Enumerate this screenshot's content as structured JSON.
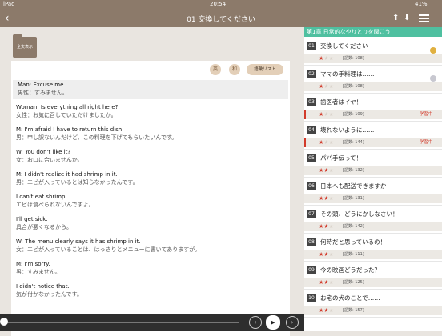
{
  "status": {
    "carrier": "iPad",
    "time": "20:54",
    "battery": "41%"
  },
  "nav": {
    "back_icon": "‹",
    "title": "01 交換してください",
    "up_icon": "⬆",
    "down_icon": "⬇"
  },
  "left": {
    "full_text_label": "全文表示",
    "btn_en": "英",
    "btn_jp": "和",
    "vocab_label": "語彙リスト",
    "lines": [
      {
        "en": "Man: Excuse me.",
        "jp": "男性：すみません。"
      },
      {
        "en": "Woman: Is everything all right here?",
        "jp": "女性：お気に召していただけましたか。"
      },
      {
        "en": "M: I'm afraid I have to return this dish.",
        "jp": "男：申し訳ないんだけど、この料理を下げてもらいたいんです。"
      },
      {
        "en": "W: You don't like it?",
        "jp": "女：お口に合いませんか。"
      },
      {
        "en": "M: I didn't realize it had shrimp in it.",
        "jp": "男：エビが入っているとは知らなかったんです。"
      },
      {
        "en": "I can't eat shrimp.",
        "jp": "エビは食べられないんですよ。"
      },
      {
        "en": "I'll get sick.",
        "jp": "具合が悪くなるから。"
      },
      {
        "en": "W: The menu clearly says it has shrimp in it.",
        "jp": "女：エビが入っていることは、はっきりとメニューに書いてありますが。"
      },
      {
        "en": "M: I'm sorry.",
        "jp": "男：すみません。"
      },
      {
        "en": "I didn't notice that.",
        "jp": "気が付かなかったんです。"
      }
    ]
  },
  "player": {
    "prev_icon": "‹",
    "play_icon": "▶",
    "next_icon": "›"
  },
  "right": {
    "chapter": "第1章 日常的なやりとりを聞こう",
    "items": [
      {
        "num": "01",
        "title": "交換してください",
        "stars": 1,
        "count": "[語数: 108]",
        "badge": "",
        "medal": "gold"
      },
      {
        "num": "02",
        "title": "ママの手料理は……",
        "stars": 1,
        "count": "[語数: 108]",
        "badge": "",
        "medal": "silver"
      },
      {
        "num": "03",
        "title": "歯医者はイヤ！",
        "stars": 1,
        "count": "[語数: 109]",
        "badge": "学習中",
        "medal": ""
      },
      {
        "num": "04",
        "title": "壊れないように……",
        "stars": 1,
        "count": "[語数: 144]",
        "badge": "学習中",
        "medal": ""
      },
      {
        "num": "05",
        "title": "パパ手伝って！",
        "stars": 2,
        "count": "[語数: 132]",
        "badge": "",
        "medal": ""
      },
      {
        "num": "06",
        "title": "日本へも配送できますか",
        "stars": 2,
        "count": "[語数: 131]",
        "badge": "",
        "medal": ""
      },
      {
        "num": "07",
        "title": "その頭、どうにかしなさい！",
        "stars": 2,
        "count": "[語数: 142]",
        "badge": "",
        "medal": ""
      },
      {
        "num": "08",
        "title": "何時だと思っているの！",
        "stars": 2,
        "count": "[語数: 111]",
        "badge": "",
        "medal": ""
      },
      {
        "num": "09",
        "title": "今の映画どうだった？",
        "stars": 2,
        "count": "[語数: 125]",
        "badge": "",
        "medal": ""
      },
      {
        "num": "10",
        "title": "お宅の犬のことで……",
        "stars": 2,
        "count": "[語数: 157]",
        "badge": "",
        "medal": ""
      }
    ]
  },
  "colors": {
    "brand": "#8c7a6a",
    "chapter": "#4fc0a0",
    "star": "#d23a2a",
    "learning": "#d23a2a"
  }
}
